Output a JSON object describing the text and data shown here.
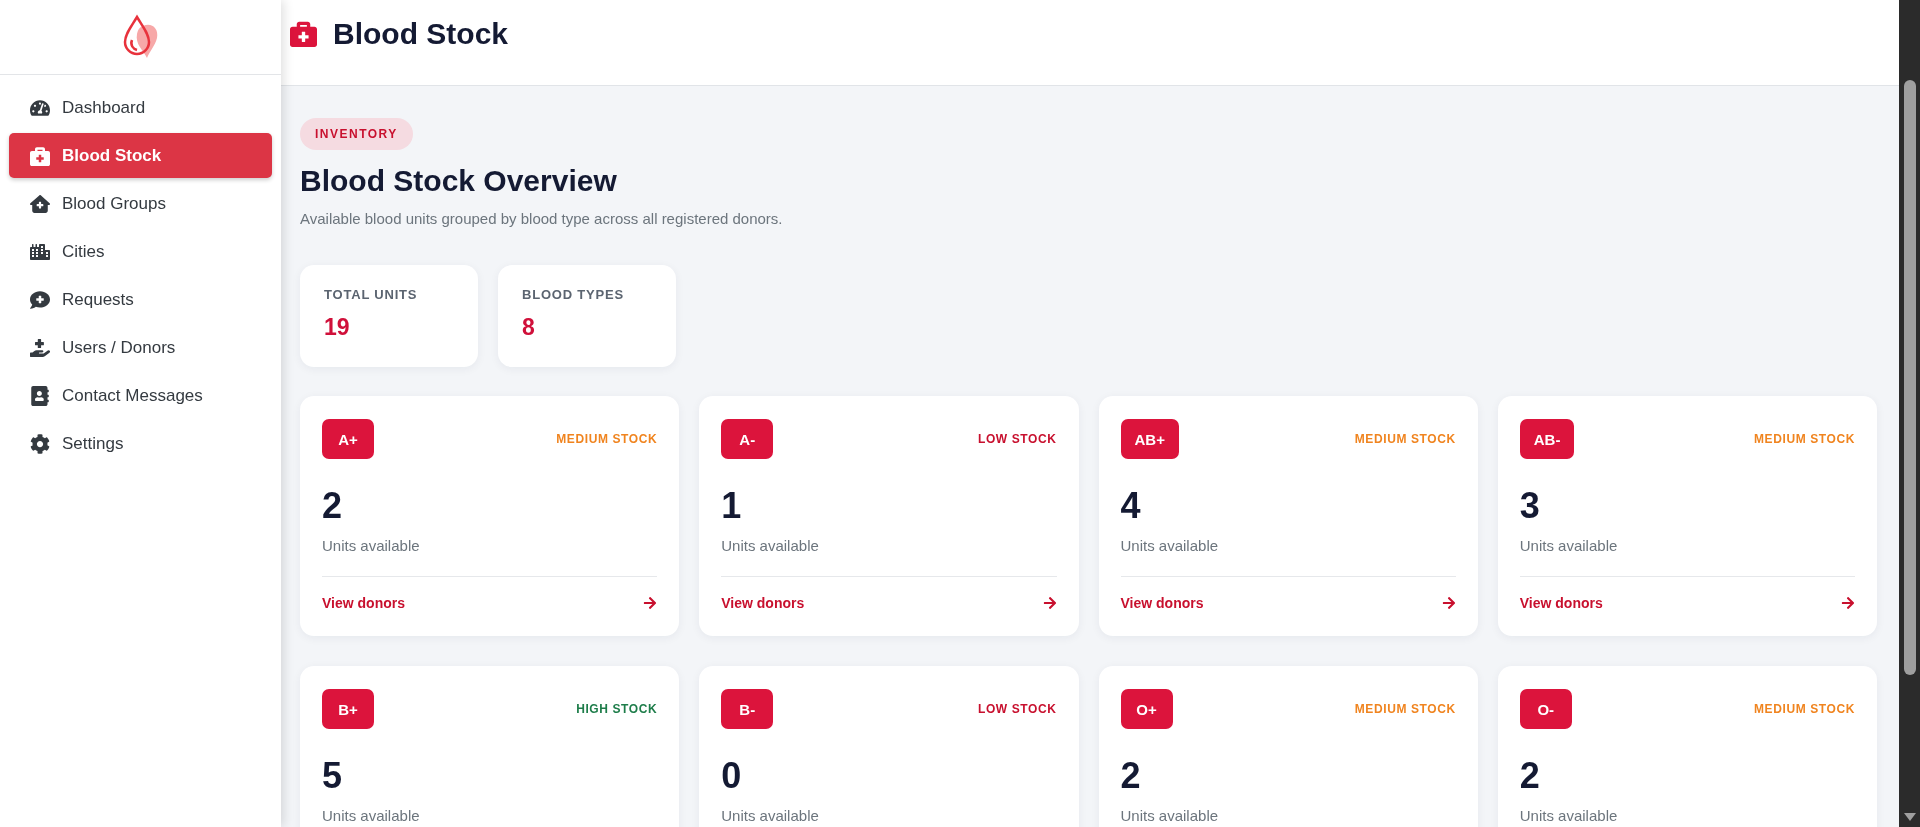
{
  "sidebar": {
    "items": [
      {
        "label": "Dashboard",
        "selected": false
      },
      {
        "label": "Blood Stock",
        "selected": true
      },
      {
        "label": "Blood Groups",
        "selected": false
      },
      {
        "label": "Cities",
        "selected": false
      },
      {
        "label": "Requests",
        "selected": false
      },
      {
        "label": "Users / Donors",
        "selected": false
      },
      {
        "label": "Contact Messages",
        "selected": false
      },
      {
        "label": "Settings",
        "selected": false
      }
    ]
  },
  "header": {
    "title": "Blood Stock"
  },
  "intro": {
    "tag": "INVENTORY",
    "title": "Blood Stock Overview",
    "subtitle": "Available blood units grouped by blood type across all registered donors."
  },
  "stats": [
    {
      "label": "TOTAL UNITS",
      "value": "19"
    },
    {
      "label": "BLOOD TYPES",
      "value": "8"
    }
  ],
  "cards": [
    {
      "group": "A+",
      "color": "#f0841f",
      "status": "MEDIUM STOCK",
      "count": "2",
      "caption": "Units available",
      "link": "View donors"
    },
    {
      "group": "A-",
      "color": "#c8102e",
      "status": "LOW STOCK",
      "count": "1",
      "caption": "Units available",
      "link": "View donors"
    },
    {
      "group": "AB+",
      "color": "#f0841f",
      "status": "MEDIUM STOCK",
      "count": "4",
      "caption": "Units available",
      "link": "View donors"
    },
    {
      "group": "AB-",
      "color": "#f0841f",
      "status": "MEDIUM STOCK",
      "count": "3",
      "caption": "Units available",
      "link": "View donors"
    },
    {
      "group": "B+",
      "color": "#1e7d4a",
      "status": "HIGH STOCK",
      "count": "5",
      "caption": "Units available"
    },
    {
      "group": "B-",
      "color": "#c8102e",
      "status": "LOW STOCK",
      "count": "0",
      "caption": "Units available"
    },
    {
      "group": "O+",
      "color": "#f0841f",
      "status": "MEDIUM STOCK",
      "count": "2",
      "caption": "Units available"
    },
    {
      "group": "O-",
      "color": "#f0841f",
      "status": "MEDIUM STOCK",
      "count": "2",
      "caption": "Units available"
    }
  ]
}
